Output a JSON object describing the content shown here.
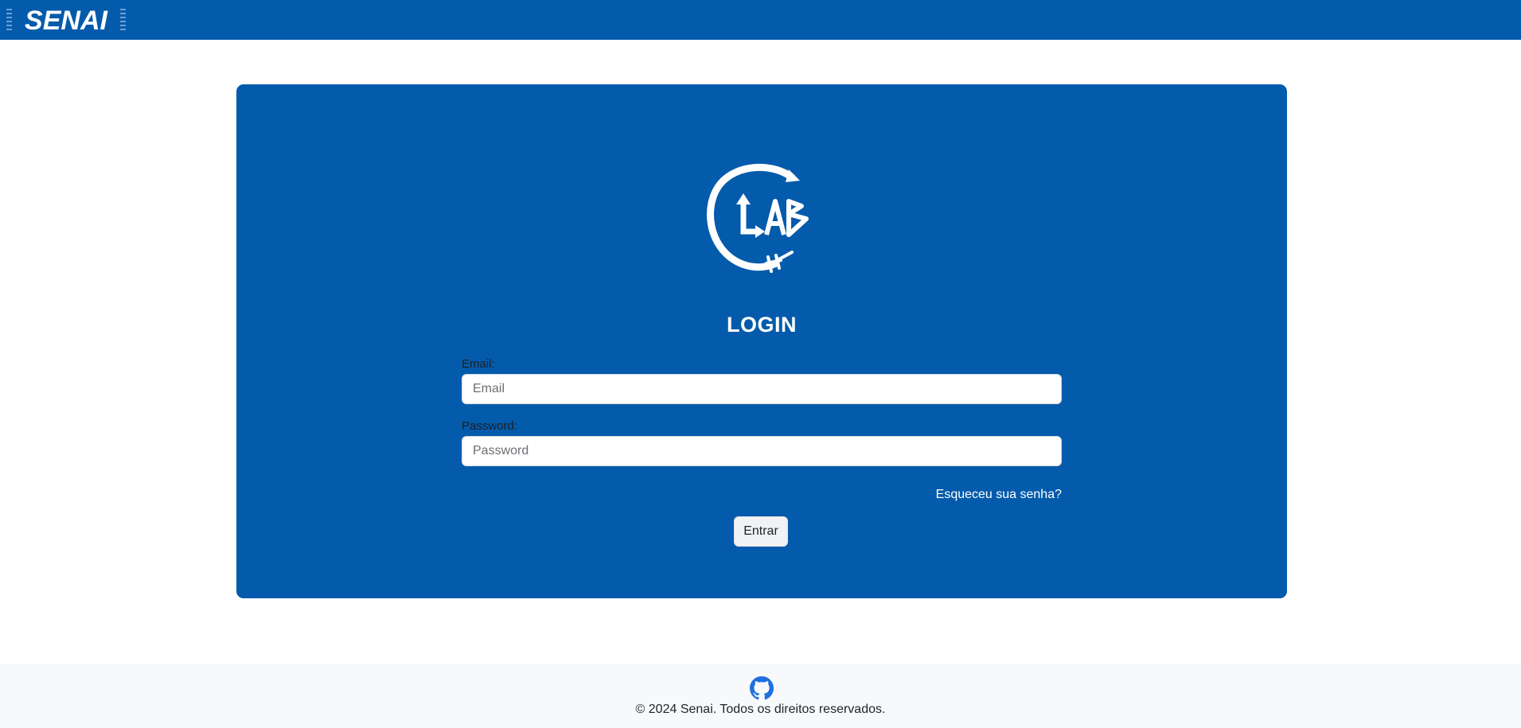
{
  "header": {
    "brand": "SENAI",
    "brand_color": "#045bac"
  },
  "login": {
    "logo_text": "LAB",
    "logo_icon": "clab-logo-icon",
    "title": "LOGIN",
    "email_label": "Email:",
    "email_placeholder": "Email",
    "email_value": "",
    "password_label": "Password:",
    "password_placeholder": "Password",
    "password_value": "",
    "forgot_link": "Esqueceu sua senha?",
    "submit_label": "Entrar"
  },
  "footer": {
    "icon": "github-icon",
    "icon_color": "#1f6fe0",
    "copyright": "© 2024 Senai. Todos os direitos reservados."
  }
}
